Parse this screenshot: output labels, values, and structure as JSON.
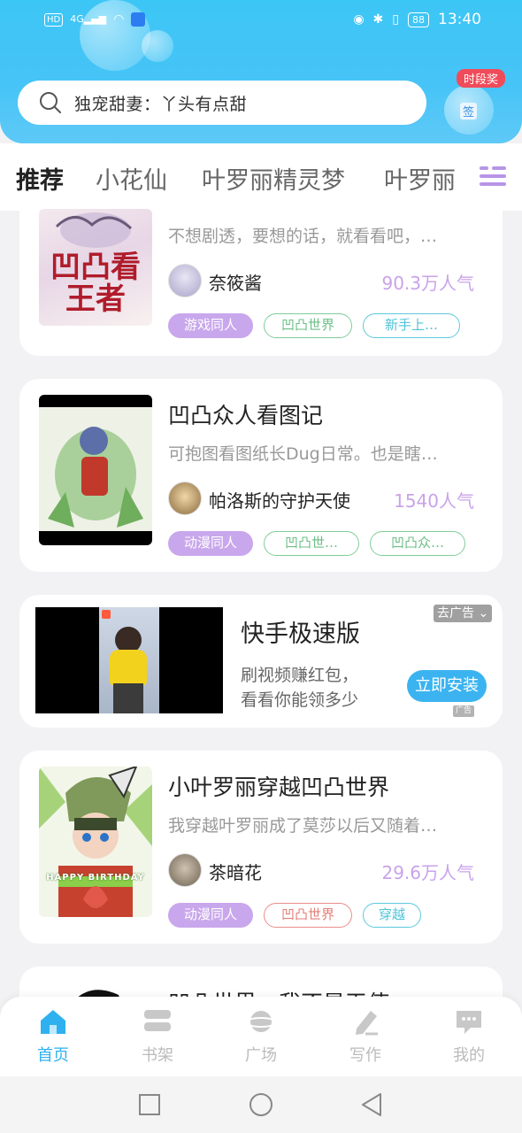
{
  "status_bar": {
    "left_badge": "HD",
    "network": "4G",
    "battery": "88",
    "time": "13:40"
  },
  "search": {
    "placeholder": "独宠甜妻：丫头有点甜"
  },
  "signin": {
    "badge": "时段奖",
    "label": "签"
  },
  "tabs": [
    {
      "label": "推荐",
      "active": true
    },
    {
      "label": "小花仙"
    },
    {
      "label": "叶罗丽精灵梦"
    },
    {
      "label": "叶罗丽"
    }
  ],
  "cards": [
    {
      "cover_text": "凹凸看王者",
      "description": "不想剧透，要想的话，就看看吧，…",
      "author": "奈筱酱",
      "popularity": "90.3万人气",
      "tags": [
        "游戏同人",
        "凹凸世界",
        "新手上…"
      ]
    },
    {
      "title": "凹凸众人看图记",
      "description": "可抱图看图纸长Dug日常。也是瞎…",
      "author": "帕洛斯的守护天使",
      "popularity": "1540人气",
      "tags": [
        "动漫同人",
        "凹凸世…",
        "凹凸众…"
      ]
    },
    {
      "title": "小叶罗丽穿越凹凸世界",
      "description": "我穿越叶罗丽成了莫莎以后又随着…",
      "author": "茶暗花",
      "popularity": "29.6万人气",
      "cover_text": "HAPPY BIRTHDAY",
      "tags": [
        "动漫同人",
        "凹凸世界",
        "穿越"
      ]
    },
    {
      "title": "凹凸世界，我不是天使"
    }
  ],
  "ad": {
    "title": "快手极速版",
    "desc_line1": "刷视频赚红包，",
    "desc_line2": "看看你能领多少",
    "button": "立即安装",
    "close": "去广告",
    "label": "广告"
  },
  "bottom_nav": [
    {
      "label": "首页",
      "icon": "home-icon",
      "active": true
    },
    {
      "label": "书架",
      "icon": "bookshelf-icon"
    },
    {
      "label": "广场",
      "icon": "planet-icon"
    },
    {
      "label": "写作",
      "icon": "pen-icon"
    },
    {
      "label": "我的",
      "icon": "chat-bubble-icon"
    }
  ],
  "colors": {
    "header": "#47c4f7",
    "accent": "#2fb1f0",
    "tab_indicator": "#b794e6",
    "popularity": "#c9a3ea"
  }
}
